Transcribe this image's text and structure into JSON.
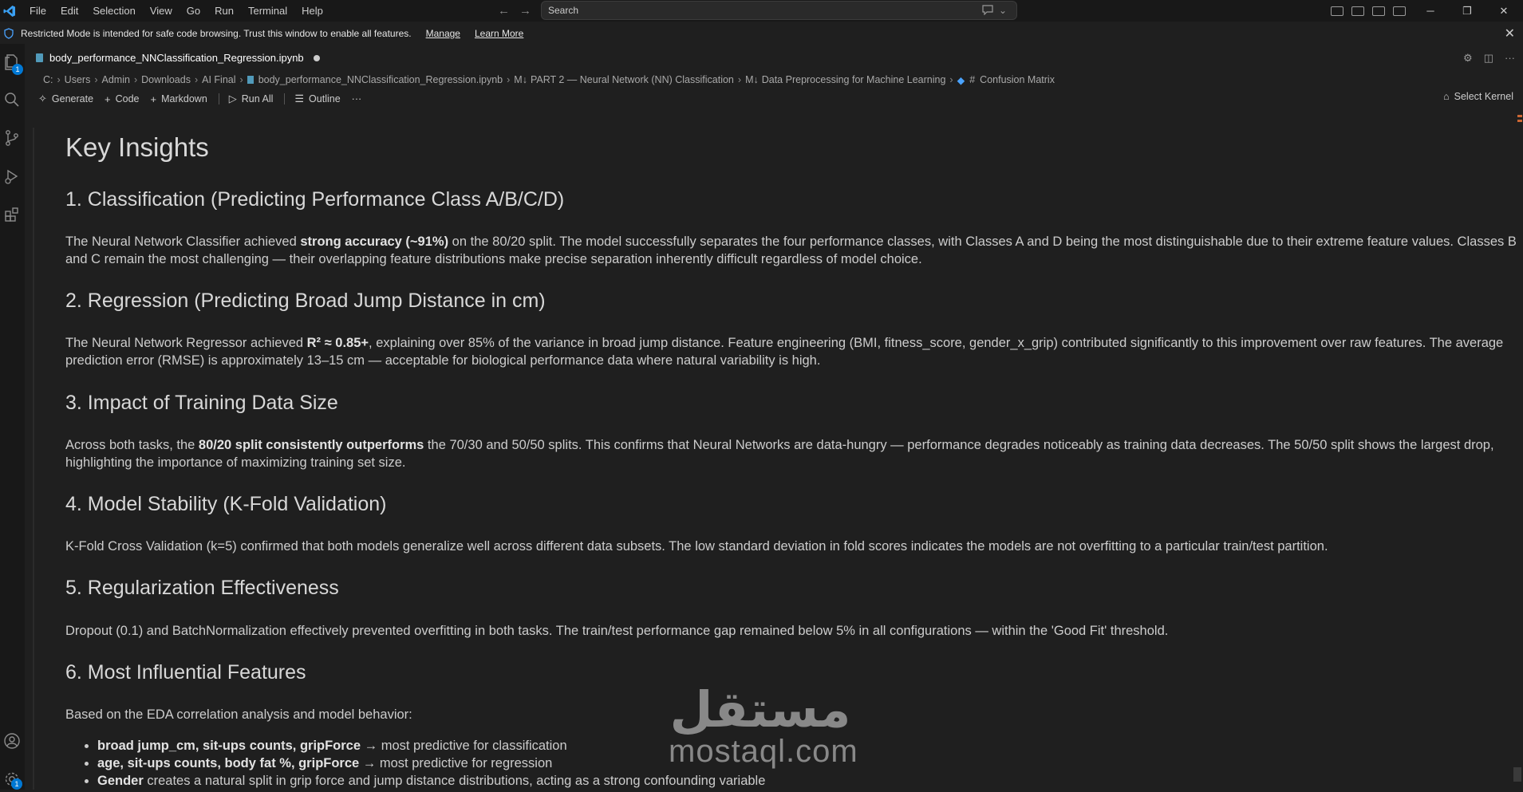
{
  "menu": [
    "File",
    "Edit",
    "Selection",
    "View",
    "Go",
    "Run",
    "Terminal",
    "Help"
  ],
  "search": {
    "placeholder": "Search"
  },
  "banner": {
    "message": "Restricted Mode is intended for safe code browsing. Trust this window to enable all features.",
    "manage": "Manage",
    "learn_more": "Learn More"
  },
  "activity": {
    "explorer_badge": "1",
    "settings_badge": "1"
  },
  "tab": {
    "filename": "body_performance_NNClassification_Regression.ipynb"
  },
  "breadcrumb": [
    "C:",
    "Users",
    "Admin",
    "Downloads",
    "AI Final",
    "body_performance_NNClassification_Regression.ipynb",
    "PART 2 — Neural Network (NN) Classification",
    "Data Preprocessing for Machine Learning",
    "Confusion Matrix"
  ],
  "breadcrumb_prefixes": {
    "md": "M↓",
    "hash": "#"
  },
  "toolbar": {
    "generate": "Generate",
    "code": "Code",
    "markdown": "Markdown",
    "run_all": "Run All",
    "outline": "Outline",
    "more": "···",
    "kernel": "Select Kernel"
  },
  "content": {
    "title": "Key Insights",
    "s1": {
      "heading": "1. Classification (Predicting Performance Class A/B/C/D)",
      "p_a": "The Neural Network Classifier achieved ",
      "p_b": "strong accuracy (~91%)",
      "p_c": " on the 80/20 split. The model successfully separates the four performance classes, with Classes A and D being the most distinguishable due to their extreme feature values. Classes B and C remain the most challenging — their overlapping feature distributions make precise separation inherently difficult regardless of model choice."
    },
    "s2": {
      "heading": "2. Regression (Predicting Broad Jump Distance in cm)",
      "p_a": "The Neural Network Regressor achieved ",
      "p_b": "R² ≈ 0.85+",
      "p_c": ", explaining over 85% of the variance in broad jump distance. Feature engineering (BMI, fitness_score, gender_x_grip) contributed significantly to this improvement over raw features. The average prediction error (RMSE) is approximately 13–15 cm — acceptable for biological performance data where natural variability is high."
    },
    "s3": {
      "heading": "3. Impact of Training Data Size",
      "p_a": "Across both tasks, the ",
      "p_b": "80/20 split consistently outperforms",
      "p_c": " the 70/30 and 50/50 splits. This confirms that Neural Networks are data-hungry — performance degrades noticeably as training data decreases. The 50/50 split shows the largest drop, highlighting the importance of maximizing training set size."
    },
    "s4": {
      "heading": "4. Model Stability (K-Fold Validation)",
      "p": "K-Fold Cross Validation (k=5) confirmed that both models generalize well across different data subsets. The low standard deviation in fold scores indicates the models are not overfitting to a particular train/test partition."
    },
    "s5": {
      "heading": "5. Regularization Effectiveness",
      "p": "Dropout (0.1) and BatchNormalization effectively prevented overfitting in both tasks. The train/test performance gap remained below 5% in all configurations — within the 'Good Fit' threshold."
    },
    "s6": {
      "heading": "6. Most Influential Features",
      "p": "Based on the EDA correlation analysis and model behavior:",
      "bullets": [
        {
          "bold": "broad jump_cm, sit-ups counts, gripForce",
          "rest": " → most predictive for classification"
        },
        {
          "bold": "age, sit-ups counts, body fat %, gripForce",
          "rest": " → most predictive for regression"
        },
        {
          "bold": "Gender",
          "rest": " creates a natural split in grip force and jump distance distributions, acting as a strong confounding variable"
        }
      ]
    }
  },
  "watermark": {
    "arabic": "مستقل",
    "latin": "mostaql.com"
  }
}
